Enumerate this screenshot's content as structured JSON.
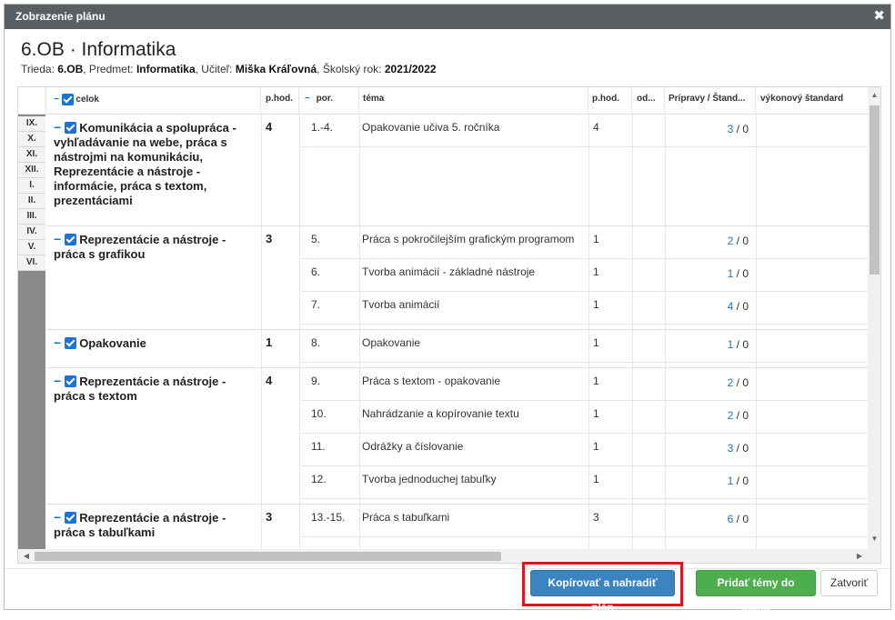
{
  "dialog": {
    "title": "Zobrazenie plánu",
    "close_icon": "close-icon"
  },
  "heading": "6.OB · Informatika",
  "subinfo": {
    "trieda_label": "Trieda: ",
    "trieda": "6.OB",
    "predmet_label": ", Predmet: ",
    "predmet": "Informatika",
    "ucitel_label": ", Učiteľ: ",
    "ucitel": "Miška Kráľovná",
    "rok_label": ", Školský rok: ",
    "rok": "2021/2022"
  },
  "columns": {
    "minus": "−",
    "celok": "celok",
    "phod": "p.hod.",
    "por_minus": "−",
    "por": "por.",
    "tema": "téma",
    "phod2": "p.hod.",
    "od": "od...",
    "pripravy": "Prípravy / Štand...",
    "vykonovy": "výkonový štandard"
  },
  "grades": [
    "IX.",
    "X.",
    "XI.",
    "XII.",
    "I.",
    "II.",
    "III.",
    "IV.",
    "V.",
    "VI."
  ],
  "groups": [
    {
      "minus": "−",
      "title": "Komunikácia a spolupráca - vyhľadávanie na webe, práca s nástrojmi na komunikáciu, Reprezentácie a nástroje - informácie, práca s textom, prezentáciami",
      "hours": "4",
      "topics": [
        {
          "por": "1.-4.",
          "tema": "Opakovanie učiva 5. ročníka",
          "phod": "4",
          "prip_link": "3",
          "prip_sep": " / ",
          "prip_std": "0"
        }
      ]
    },
    {
      "minus": "−",
      "title": "Reprezentácie a nástroje - práca s grafikou",
      "hours": "3",
      "topics": [
        {
          "por": "5.",
          "tema": "Práca s pokročilejším grafickým programom",
          "phod": "1",
          "prip_link": "2",
          "prip_sep": " / ",
          "prip_std": "0"
        },
        {
          "por": "6.",
          "tema": "Tvorba animácií - základné nástroje",
          "phod": "1",
          "prip_link": "1",
          "prip_sep": " / ",
          "prip_std": "0"
        },
        {
          "por": "7.",
          "tema": "Tvorba animácií",
          "phod": "1",
          "prip_link": "4",
          "prip_sep": " / ",
          "prip_std": "0"
        }
      ]
    },
    {
      "minus": "−",
      "title": "Opakovanie",
      "hours": "1",
      "topics": [
        {
          "por": "8.",
          "tema": "Opakovanie",
          "phod": "1",
          "prip_link": "1",
          "prip_sep": " / ",
          "prip_std": "0"
        }
      ]
    },
    {
      "minus": "−",
      "title": "Reprezentácie a nástroje - práca s textom",
      "hours": "4",
      "topics": [
        {
          "por": "9.",
          "tema": "Práca s textom - opakovanie",
          "phod": "1",
          "prip_link": "2",
          "prip_sep": " / ",
          "prip_std": "0"
        },
        {
          "por": "10.",
          "tema": "Nahrádzanie a kopírovanie textu",
          "phod": "1",
          "prip_link": "2",
          "prip_sep": " / ",
          "prip_std": "0"
        },
        {
          "por": "11.",
          "tema": "Odrážky a číslovanie",
          "phod": "1",
          "prip_link": "3",
          "prip_sep": " / ",
          "prip_std": "0"
        },
        {
          "por": "12.",
          "tema": "Tvorba jednoduchej tabuľky",
          "phod": "1",
          "prip_link": "1",
          "prip_sep": " / ",
          "prip_std": "0"
        }
      ]
    },
    {
      "minus": "−",
      "title": "Reprezentácie a nástroje - práca s tabuľkami",
      "hours": "3",
      "topics": [
        {
          "por": "13.-15.",
          "tema": "Práca s tabuľkami",
          "phod": "3",
          "prip_link": "6",
          "prip_sep": " / ",
          "prip_std": "0"
        }
      ]
    }
  ],
  "buttons": {
    "copy_replace": "Kopírovať a nahradiť plán",
    "add_topics": "Pridať témy do plánu",
    "close": "Zatvoriť"
  },
  "colors": {
    "titlebar": "#5a5f63",
    "primary": "#3a84c1",
    "success": "#4cae4c",
    "highlight": "#e0141a",
    "link": "#1a73b8"
  }
}
